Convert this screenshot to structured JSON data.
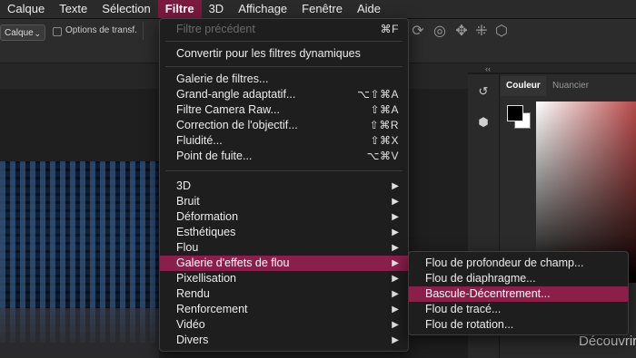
{
  "menubar": {
    "items": [
      "Calque",
      "Texte",
      "Sélection",
      "Filtre",
      "3D",
      "Affichage",
      "Fenêtre",
      "Aide"
    ],
    "active_index": 3
  },
  "options_bar": {
    "layer_select": "Calque",
    "transform_options_label": "Options de transf."
  },
  "filter_menu": {
    "last_filter": "Filtre précédent",
    "last_filter_shortcut": "⌘F",
    "convert": "Convertir pour les filtres dynamiques",
    "group1": [
      {
        "label": "Galerie de filtres...",
        "shortcut": ""
      },
      {
        "label": "Grand-angle adaptatif...",
        "shortcut": "⌥⇧⌘A"
      },
      {
        "label": "Filtre Camera Raw...",
        "shortcut": "⇧⌘A"
      },
      {
        "label": "Correction de l'objectif...",
        "shortcut": "⇧⌘R"
      },
      {
        "label": "Fluidité...",
        "shortcut": "⇧⌘X"
      },
      {
        "label": "Point de fuite...",
        "shortcut": "⌥⌘V"
      }
    ],
    "submenus": [
      {
        "label": "3D"
      },
      {
        "label": "Bruit"
      },
      {
        "label": "Déformation"
      },
      {
        "label": "Esthétiques"
      },
      {
        "label": "Flou"
      },
      {
        "label": "Galerie d'effets de flou",
        "highlighted": true
      },
      {
        "label": "Pixellisation"
      },
      {
        "label": "Rendu"
      },
      {
        "label": "Renforcement"
      },
      {
        "label": "Vidéo"
      },
      {
        "label": "Divers"
      }
    ],
    "submenu_arrow": "▶"
  },
  "blur_gallery_menu": {
    "items": [
      {
        "label": "Flou de profondeur de champ..."
      },
      {
        "label": "Flou de diaphragme..."
      },
      {
        "label": "Bascule-Décentrement...",
        "highlighted": true
      },
      {
        "label": "Flou de tracé..."
      },
      {
        "label": "Flou de rotation..."
      }
    ]
  },
  "right_panel": {
    "collapse_arrows": "‹‹",
    "tabs": [
      "Couleur",
      "Nuancier"
    ],
    "active_tab": 0,
    "tools": [
      "history-icon",
      "3d-cube-icon"
    ]
  },
  "canvas": {
    "discover_text": "Découvrir"
  },
  "colors": {
    "highlight": "#8a1f49",
    "menubar_active": "#7a1a3e",
    "menu_bg": "#1e1e1e",
    "foreground_swatch": "#000000",
    "background_swatch": "#ffffff"
  }
}
